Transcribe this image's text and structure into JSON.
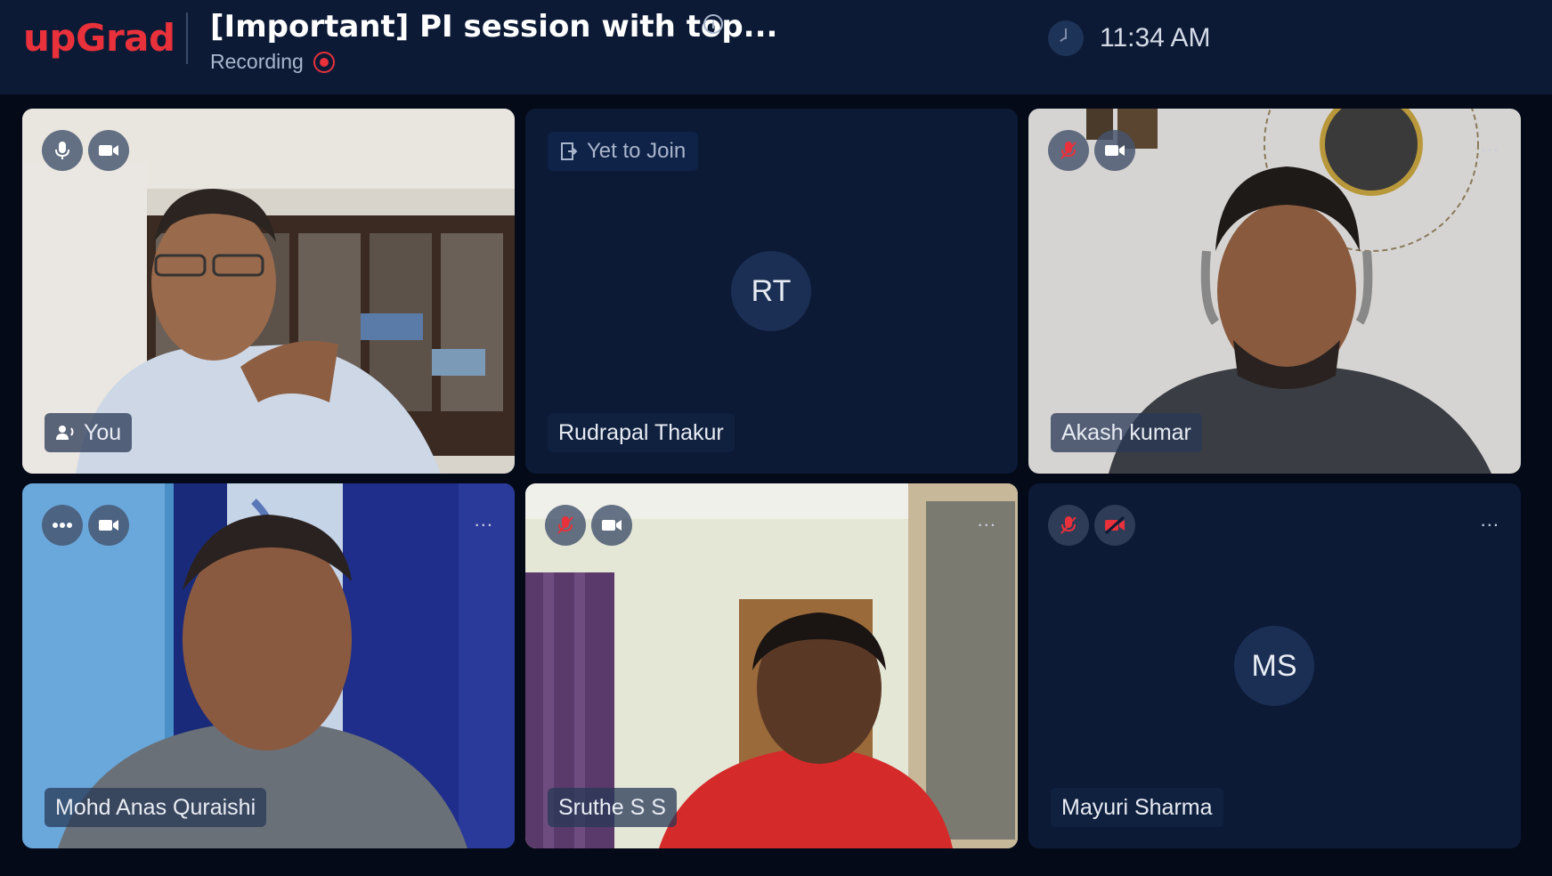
{
  "header": {
    "logo": "upGrad",
    "title": "[Important] PI session with top...",
    "info_icon": "i",
    "recording_label": "Recording",
    "time": "11:34 AM",
    "colors": {
      "brand": "#e8313a",
      "bar": "#0c1a36"
    }
  },
  "tiles": [
    {
      "name": "You",
      "type": "video",
      "mic": "speaking",
      "camera": "on"
    },
    {
      "name": "Rudrapal Thakur",
      "type": "avatar",
      "initials": "RT",
      "status": "Yet to Join"
    },
    {
      "name": "Akash kumar",
      "type": "video",
      "mic": "muted",
      "camera": "on",
      "menu": "..."
    },
    {
      "name": "Mohd Anas Quraishi",
      "type": "video",
      "mic": "speaking-dots",
      "camera": "on",
      "menu": "..."
    },
    {
      "name": "Sruthe S S",
      "type": "video",
      "mic": "muted",
      "camera": "on",
      "menu": "..."
    },
    {
      "name": "Mayuri Sharma",
      "type": "avatar",
      "initials": "MS",
      "mic": "muted",
      "camera": "off",
      "menu": "..."
    }
  ]
}
